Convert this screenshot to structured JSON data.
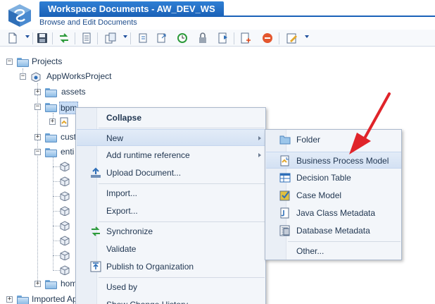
{
  "header": {
    "title": "Workspace Documents - AW_DEV_WS",
    "subtitle": "Browse and Edit Documents"
  },
  "toolbar": {
    "buttons": [
      "new-document-icon",
      "save-icon",
      "synchronize-icon",
      "document-icon",
      "copy-icon",
      "import-icon",
      "export-icon",
      "history-icon",
      "lock-icon",
      "publish-icon",
      "new-page-icon",
      "delete-icon",
      "edit-icon"
    ]
  },
  "tree": {
    "projects": "Projects",
    "project": "AppWorksProject",
    "assets": "assets",
    "bpm": "bpm",
    "cust": "cust",
    "enti": "enti",
    "hom": "hom",
    "imported": "Imported Ap"
  },
  "context_menu": {
    "collapse": "Collapse",
    "new": "New",
    "add_runtime_reference": "Add runtime reference",
    "upload_document": "Upload Document...",
    "import": "Import...",
    "export": "Export...",
    "synchronize": "Synchronize",
    "validate": "Validate",
    "publish": "Publish to Organization",
    "used_by": "Used by",
    "show_change_history": "Show Change History"
  },
  "submenu": {
    "folder": "Folder",
    "business_process_model": "Business Process Model",
    "decision_table": "Decision Table",
    "case_model": "Case Model",
    "java_class_metadata": "Java Class Metadata",
    "database_metadata": "Database Metadata",
    "other": "Other..."
  },
  "colors": {
    "accent": "#1b62b8",
    "annotation_arrow": "#e0242a",
    "menu_background": "#f3f6fa",
    "hover_background": "#d3e1f3"
  }
}
